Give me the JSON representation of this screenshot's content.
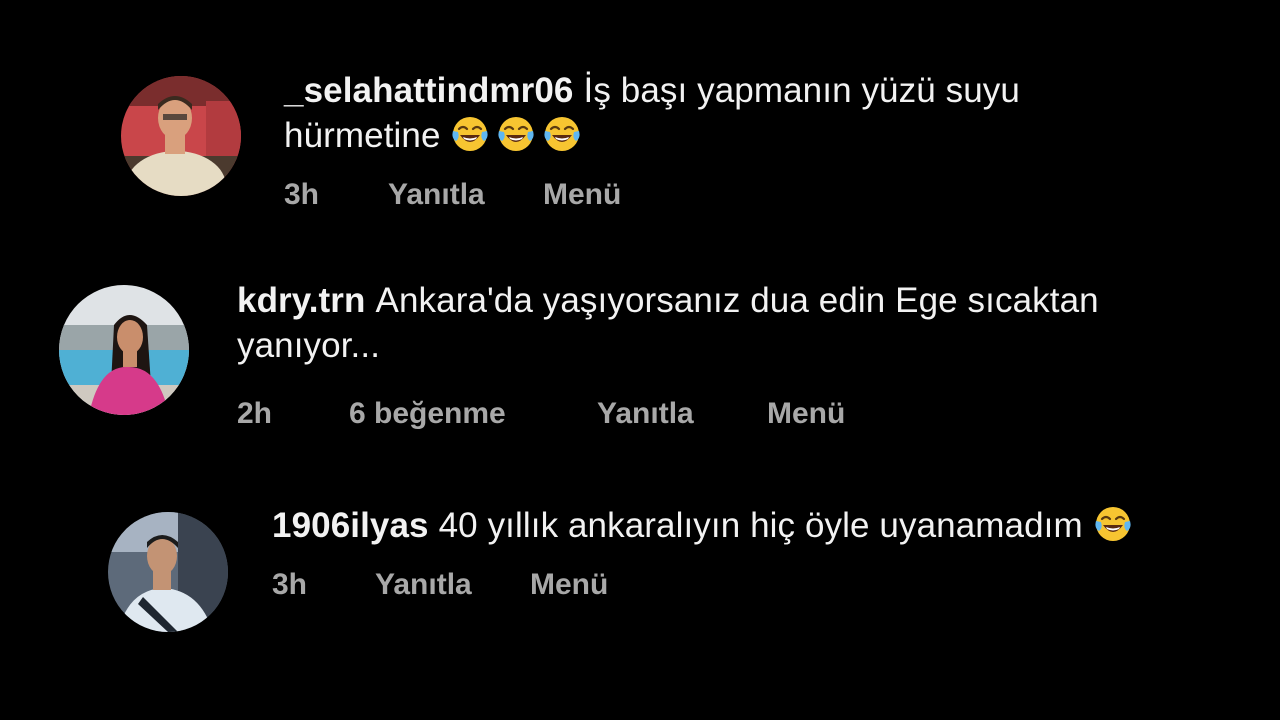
{
  "comments": [
    {
      "username": "_selahattindmr06",
      "text": "İş başı yapmanın yüzü suyu hürmetine",
      "emojis": [
        "face-with-tears-of-joy",
        "face-with-tears-of-joy",
        "face-with-tears-of-joy"
      ],
      "time": "3h",
      "reply_label": "Yanıtla",
      "menu_label": "Menü"
    },
    {
      "username": "kdry.trn",
      "text": "Ankara'da yaşıyorsanız dua edin Ege sıcaktan yanıyor...",
      "time": "2h",
      "likes_label": "6 beğenme",
      "reply_label": "Yanıtla",
      "menu_label": "Menü"
    },
    {
      "username": "1906ilyas",
      "text": "40 yıllık ankaralıyın hiç öyle uyanamadım",
      "emojis": [
        "face-with-tears-of-joy"
      ],
      "time": "3h",
      "reply_label": "Yanıtla",
      "menu_label": "Menü"
    }
  ],
  "colors": {
    "background": "#000000",
    "text": "#f2f2f2",
    "meta_text": "#a8a8a8"
  }
}
